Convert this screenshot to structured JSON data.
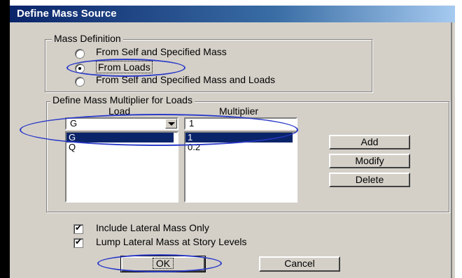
{
  "window": {
    "title": "Define Mass Source"
  },
  "mass_definition": {
    "legend": "Mass Definition",
    "options": [
      {
        "label": "From Self and Specified Mass",
        "selected": false
      },
      {
        "label": "From Loads",
        "selected": true
      },
      {
        "label": "From Self and Specified Mass and Loads",
        "selected": false
      }
    ]
  },
  "multiplier_group": {
    "legend": "Define Mass Multiplier for Loads",
    "load_header": "Load",
    "multiplier_header": "Multiplier",
    "load_select_value": "G",
    "multiplier_input_value": "1",
    "rows": [
      {
        "load": "G",
        "multiplier": "1",
        "selected": true
      },
      {
        "load": "Q",
        "multiplier": "0.2",
        "selected": false
      }
    ],
    "buttons": {
      "add": "Add",
      "modify": "Modify",
      "delete": "Delete"
    }
  },
  "options": {
    "include_lateral": {
      "label": "Include Lateral Mass Only",
      "checked": true
    },
    "lump_lateral": {
      "label": "Lump Lateral Mass at Story Levels",
      "checked": true
    }
  },
  "footer": {
    "ok": "OK",
    "cancel": "Cancel"
  },
  "colors": {
    "highlight_ellipse": "#2b3ac8",
    "selection": "#0a246a",
    "dialog_bg": "#d4d0c8"
  }
}
